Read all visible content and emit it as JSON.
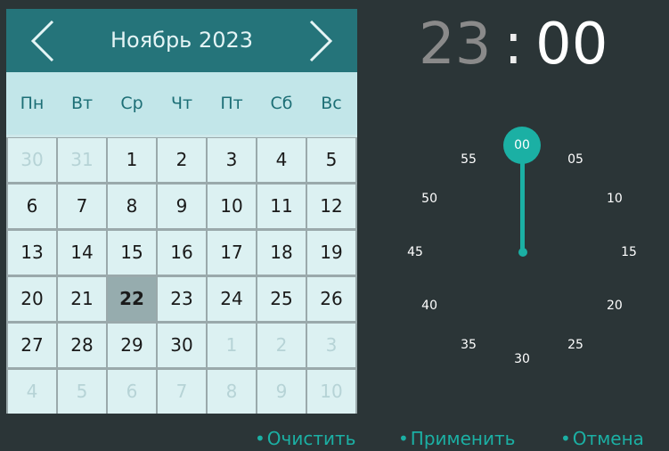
{
  "calendar": {
    "month_title": "Ноябрь 2023",
    "weekdays": [
      "Пн",
      "Вт",
      "Ср",
      "Чт",
      "Пт",
      "Сб",
      "Вс"
    ],
    "weeks": [
      [
        {
          "d": "30",
          "other": true
        },
        {
          "d": "31",
          "other": true
        },
        {
          "d": "1"
        },
        {
          "d": "2"
        },
        {
          "d": "3"
        },
        {
          "d": "4"
        },
        {
          "d": "5"
        }
      ],
      [
        {
          "d": "6"
        },
        {
          "d": "7"
        },
        {
          "d": "8"
        },
        {
          "d": "9"
        },
        {
          "d": "10"
        },
        {
          "d": "11"
        },
        {
          "d": "12"
        }
      ],
      [
        {
          "d": "13"
        },
        {
          "d": "14"
        },
        {
          "d": "15"
        },
        {
          "d": "16"
        },
        {
          "d": "17"
        },
        {
          "d": "18"
        },
        {
          "d": "19"
        }
      ],
      [
        {
          "d": "20"
        },
        {
          "d": "21"
        },
        {
          "d": "22",
          "selected": true
        },
        {
          "d": "23"
        },
        {
          "d": "24"
        },
        {
          "d": "25"
        },
        {
          "d": "26"
        }
      ],
      [
        {
          "d": "27"
        },
        {
          "d": "28"
        },
        {
          "d": "29"
        },
        {
          "d": "30"
        },
        {
          "d": "1",
          "other": true
        },
        {
          "d": "2",
          "other": true
        },
        {
          "d": "3",
          "other": true
        }
      ],
      [
        {
          "d": "4",
          "other": true
        },
        {
          "d": "5",
          "other": true
        },
        {
          "d": "6",
          "other": true
        },
        {
          "d": "7",
          "other": true
        },
        {
          "d": "8",
          "other": true
        },
        {
          "d": "9",
          "other": true
        },
        {
          "d": "10",
          "other": true
        }
      ]
    ]
  },
  "time": {
    "hour": "23",
    "separator": ":",
    "minute": "00",
    "selected_minute_label": "00",
    "minute_labels": [
      "05",
      "10",
      "15",
      "20",
      "25",
      "30",
      "35",
      "40",
      "45",
      "50",
      "55"
    ]
  },
  "actions": {
    "bullet": "•",
    "clear": "Очистить",
    "apply": "Применить",
    "cancel": "Отмена"
  },
  "colors": {
    "background": "#2b3537",
    "header": "#25747a",
    "weekday_row": "#c2e6e9",
    "day_cell": "#dcf1f2",
    "selected_day": "#96acae",
    "accent": "#1bb0a4"
  },
  "icons": {
    "prev": "chevron-left-icon",
    "next": "chevron-right-icon"
  }
}
